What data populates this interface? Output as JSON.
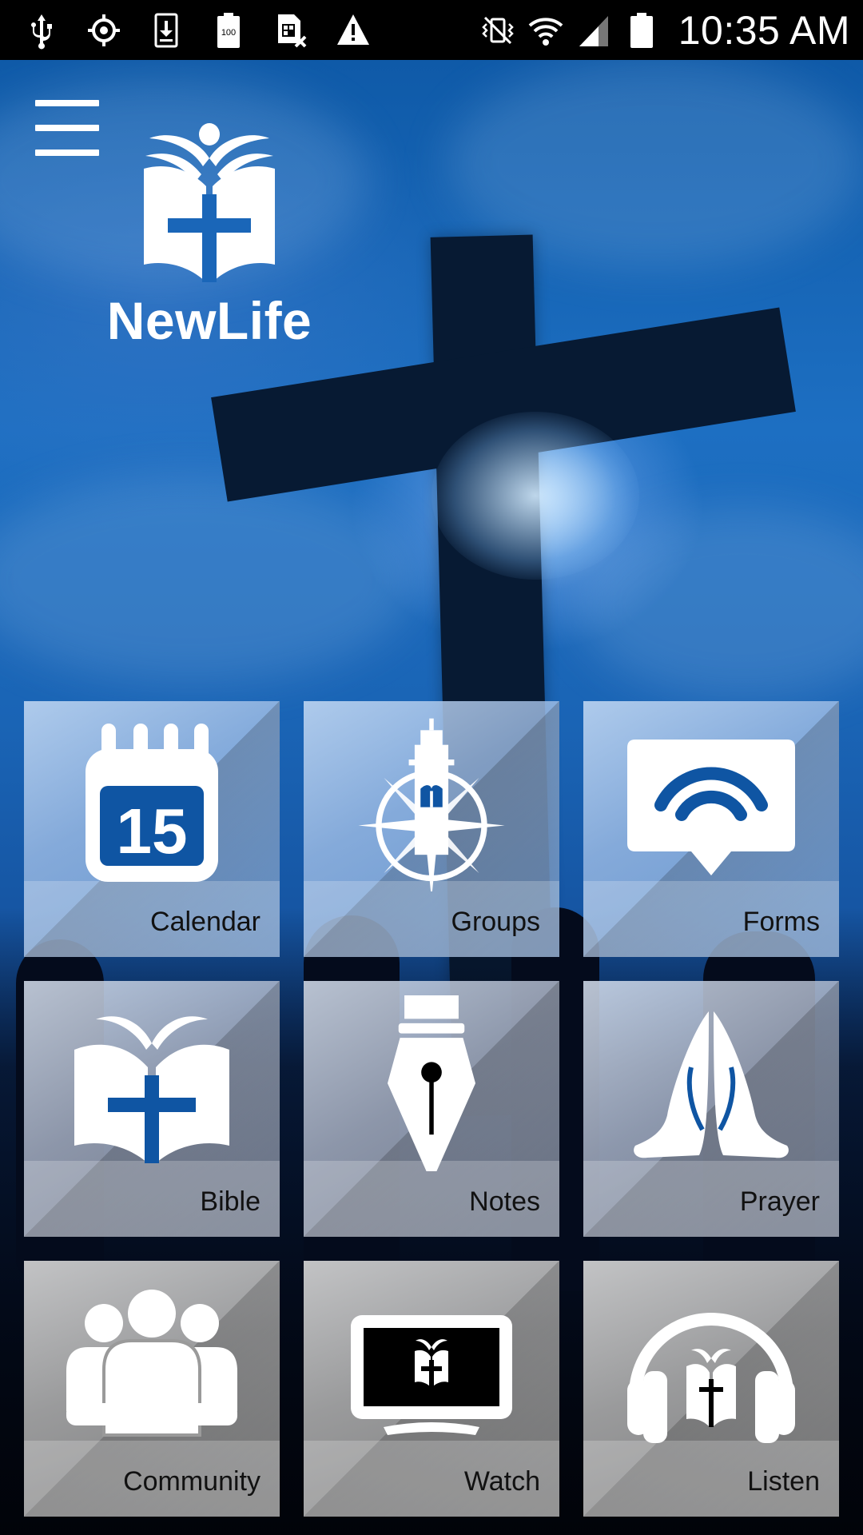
{
  "status_bar": {
    "time": "10:35 AM",
    "battery_level_label": "100",
    "left_icons": [
      "usb-icon",
      "gps-icon",
      "download-icon",
      "battery-100-icon",
      "sim-card-error-icon",
      "warning-icon"
    ],
    "right_icons": [
      "vibrate-mute-icon",
      "wifi-icon",
      "signal-icon",
      "battery-icon"
    ]
  },
  "app": {
    "logo_text": "NewLife",
    "menu_icon": "hamburger-menu-icon"
  },
  "tiles": [
    {
      "label": "Calendar",
      "icon": "calendar-icon",
      "calendar_day": "15"
    },
    {
      "label": "Groups",
      "icon": "lighthouse-compass-icon"
    },
    {
      "label": "Forms",
      "icon": "wifi-message-icon"
    },
    {
      "label": "Bible",
      "icon": "bible-icon"
    },
    {
      "label": "Notes",
      "icon": "fountain-pen-icon"
    },
    {
      "label": "Prayer",
      "icon": "praying-hands-icon"
    },
    {
      "label": "Community",
      "icon": "people-icon"
    },
    {
      "label": "Watch",
      "icon": "tv-icon"
    },
    {
      "label": "Listen",
      "icon": "headphones-icon"
    }
  ],
  "colors": {
    "brand_blue": "#0f55a3",
    "icon_white": "#ffffff",
    "status_bar_bg": "#000000"
  }
}
